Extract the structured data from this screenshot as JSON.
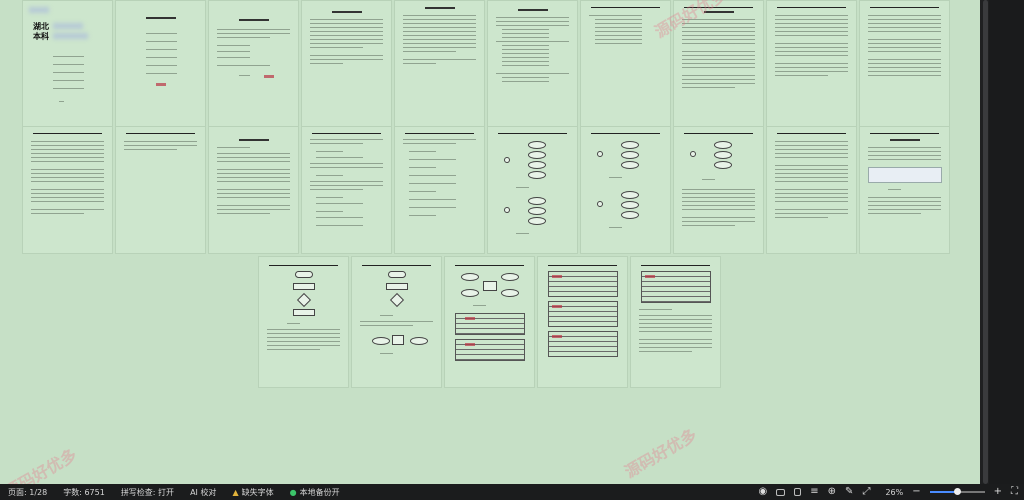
{
  "document": {
    "cover": {
      "line1": "湖北",
      "line2": "本科"
    },
    "watermark": "源码好优多"
  },
  "statusbar": {
    "page": "页面: 1/28",
    "words": "字数: 6751",
    "spell": "拼写检查: 打开",
    "ai": "AI 校对",
    "missing_font": "缺失字体",
    "backup": "本地备份开",
    "zoom": "26%",
    "zoom_value": 0.26
  },
  "colors": {
    "page_bg": "#cde6cd",
    "statusbar_bg": "#1b1c1d",
    "warning": "#e2b33b",
    "ok": "#3cc46a"
  },
  "icons": [
    "eye-icon",
    "read-mode-icon",
    "page-view-icon",
    "outline-icon",
    "web-view-icon",
    "pen-icon",
    "fit-icon",
    "zoom-out-icon",
    "zoom-in-icon",
    "fullscreen-icon"
  ]
}
